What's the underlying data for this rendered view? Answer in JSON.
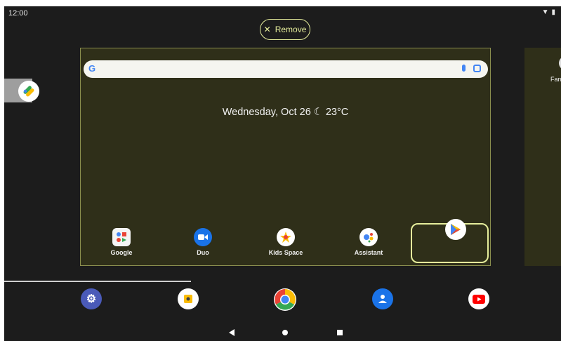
{
  "status_bar": {
    "time": "12:00",
    "wifi_icon": "wifi-icon",
    "battery_icon": "battery-icon"
  },
  "remove_button": {
    "label": "Remove",
    "icon": "close-icon"
  },
  "search_bar": {
    "logo": "G",
    "mic_icon": "mic-icon",
    "lens_icon": "lens-icon"
  },
  "at_a_glance": {
    "text": "Wednesday, Oct 26",
    "weather_icon": "moon-icon",
    "temperature": "23°C"
  },
  "dock_apps": [
    {
      "label": "Google",
      "icon": "google-folder-icon"
    },
    {
      "label": "Duo",
      "icon": "duo-icon"
    },
    {
      "label": "Kids Space",
      "icon": "kids-space-icon"
    },
    {
      "label": "Assistant",
      "icon": "assistant-icon"
    }
  ],
  "dragged_app": {
    "icon": "play-store-icon"
  },
  "right_page": {
    "label": "Fam"
  },
  "hotseat": [
    {
      "icon": "settings-icon"
    },
    {
      "icon": "camera-icon"
    },
    {
      "icon": "chrome-icon"
    },
    {
      "icon": "contacts-icon"
    },
    {
      "icon": "youtube-icon"
    }
  ],
  "nav_bar": {
    "back": "back-icon",
    "home": "home-icon",
    "recents": "recents-icon"
  },
  "colors": {
    "accent": "#e6ee9c",
    "panel": "#2f2f19",
    "background": "#1c1c1c"
  }
}
